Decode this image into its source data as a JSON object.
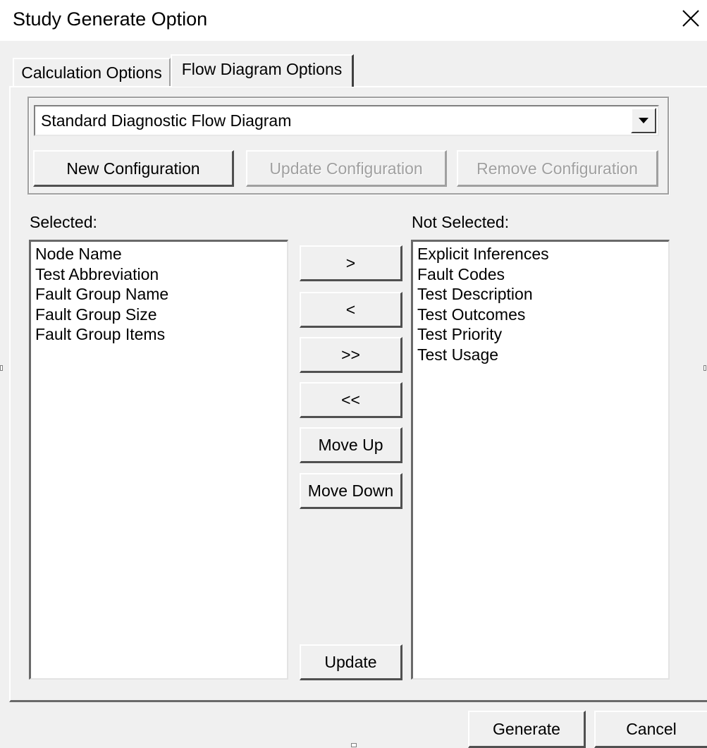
{
  "window": {
    "title": "Study Generate Option",
    "close_icon": "close-icon"
  },
  "tabs": [
    {
      "label": "Calculation Options",
      "active": false
    },
    {
      "label": "Flow Diagram Options",
      "active": true
    }
  ],
  "configuration": {
    "selected_value": "Standard Diagnostic Flow Diagram",
    "new_label": "New Configuration",
    "update_label": "Update Configuration",
    "remove_label": "Remove Configuration"
  },
  "selected": {
    "label": "Selected:",
    "items": [
      "Node Name",
      "Test Abbreviation",
      "Fault Group Name",
      "Fault Group Size",
      "Fault Group Items"
    ]
  },
  "not_selected": {
    "label": "Not Selected:",
    "items": [
      "Explicit Inferences",
      "Fault Codes",
      "Test Description",
      "Test Outcomes",
      "Test Priority",
      "Test Usage"
    ]
  },
  "move_buttons": {
    "add": ">",
    "remove": "<",
    "add_all": ">>",
    "remove_all": "<<",
    "move_up": "Move Up",
    "move_down": "Move Down",
    "update": "Update"
  },
  "footer": {
    "generate_label": "Generate",
    "cancel_label": "Cancel"
  },
  "colors": {
    "dialog_bg": "#f0f0f0",
    "titlebar_bg": "#ffffff",
    "disabled_text": "#a0a0a0"
  }
}
